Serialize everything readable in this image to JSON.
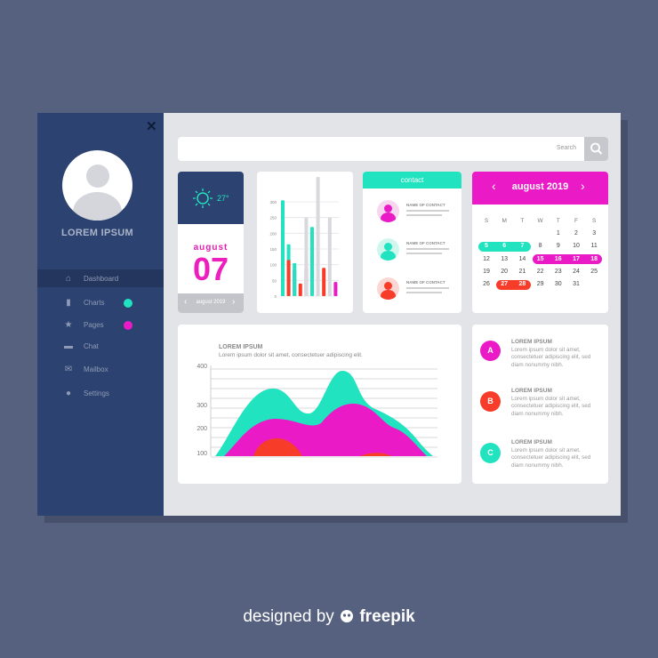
{
  "window": {
    "close_label": "✕"
  },
  "profile": {
    "name": "LOREM IPSUM"
  },
  "nav": [
    {
      "label": "Dashboard",
      "icon": "home-icon",
      "glyph": "⌂",
      "active": true
    },
    {
      "label": "Charts",
      "icon": "bar-chart-icon",
      "glyph": "▮",
      "dot_color": "#21e3bf"
    },
    {
      "label": "Pages",
      "icon": "star-icon",
      "glyph": "★",
      "dot_color": "#ea1bc6"
    },
    {
      "label": "Chat",
      "icon": "chat-icon",
      "glyph": "▬"
    },
    {
      "label": "Mailbox",
      "icon": "mail-icon",
      "glyph": "✉"
    },
    {
      "label": "Settings",
      "icon": "gear-icon",
      "glyph": "●"
    }
  ],
  "search": {
    "placeholder": "Search"
  },
  "weather": {
    "temperature": "27°",
    "month": "august",
    "day": "07",
    "nav_label": "august 2019",
    "prev": "‹",
    "next": "›"
  },
  "bar_chart": {
    "y_ticks": [
      "0",
      "50",
      "100",
      "150",
      "200",
      "250",
      "300"
    ],
    "ylim": [
      0,
      300
    ],
    "colors": [
      "#ea1bc6",
      "#21e3bf",
      "#f73c2a",
      "#d8d9dc"
    ],
    "groups": [
      {
        "values": [
          115,
          305,
          0,
          0
        ]
      },
      {
        "values": [
          0,
          165,
          115,
          0
        ]
      },
      {
        "values": [
          85,
          105,
          0,
          0
        ]
      },
      {
        "values": [
          0,
          0,
          40,
          0
        ]
      },
      {
        "values": [
          90,
          0,
          0,
          250
        ]
      },
      {
        "values": [
          0,
          220,
          0,
          0
        ]
      },
      {
        "values": [
          0,
          0,
          0,
          380
        ]
      },
      {
        "values": [
          0,
          0,
          90,
          0
        ]
      },
      {
        "values": [
          0,
          0,
          0,
          250
        ]
      },
      {
        "values": [
          45,
          0,
          0,
          0
        ]
      }
    ]
  },
  "contact": {
    "header": "contact",
    "items": [
      {
        "name": "NAME OF CONTACT",
        "color": "#ea1bc6",
        "bg": "#f7d6ef"
      },
      {
        "name": "NAME OF CONTACT",
        "color": "#21e3bf",
        "bg": "#cff7ee"
      },
      {
        "name": "NAME OF CONTACT",
        "color": "#f73c2a",
        "bg": "#fcd6d3"
      }
    ]
  },
  "calendar": {
    "title": "august 2019",
    "prev": "‹",
    "next": "›",
    "weekdays": [
      "S",
      "M",
      "T",
      "W",
      "T",
      "F",
      "S"
    ],
    "rows": [
      [
        "",
        "",
        "",
        "",
        "1",
        "2",
        "3"
      ],
      [
        "4",
        "5",
        "6",
        "7",
        "8",
        "9",
        "10"
      ],
      [
        "11",
        "12",
        "13",
        "14",
        "15",
        "16",
        "17"
      ],
      [
        "18",
        "19",
        "20",
        "21",
        "22",
        "23",
        "24"
      ],
      [
        "25",
        "26",
        "27",
        "28",
        "29",
        "30",
        "31"
      ]
    ],
    "display_rows": [
      [
        "",
        "",
        "",
        "",
        "1",
        "2",
        "3"
      ],
      [
        "4",
        "5",
        "6",
        "7",
        "8",
        "9",
        "10",
        "11"
      ],
      [
        "12",
        "13",
        "14",
        "15",
        "16",
        "17",
        "18"
      ],
      [
        "19",
        "20",
        "21",
        "22",
        "23",
        "24",
        "25"
      ],
      [
        "26",
        "27",
        "28",
        "29",
        "30",
        "31"
      ]
    ],
    "highlight_green": [
      "5",
      "6",
      "7"
    ],
    "highlight_magenta": [
      "15",
      "16",
      "17",
      "18"
    ],
    "highlight_red": [
      "27",
      "28"
    ],
    "green": "#21e3bf",
    "magenta": "#ea1bc6",
    "red": "#f73c2a"
  },
  "area_chart": {
    "title": "LOREM IPSUM",
    "subtitle": "Lorem ipsum dolor sit amet, consectetuer adipiscing elit.",
    "y_ticks": [
      "400",
      "300",
      "200",
      "100"
    ]
  },
  "list": [
    {
      "letter": "A",
      "color": "#ea1bc6",
      "title": "LOREM IPSUM",
      "text": "Lorem ipsum dolor sit amet, consectetuer adipiscing elit, sed diam nonummy nibh."
    },
    {
      "letter": "B",
      "color": "#f73c2a",
      "title": "LOREM IPSUM",
      "text": "Lorem ipsum dolor sit amet, consectetuer adipiscing elit, sed diam nonummy nibh."
    },
    {
      "letter": "C",
      "color": "#21e3bf",
      "title": "LOREM IPSUM",
      "text": "Lorem ipsum dolor sit amet, consectetuer adipiscing elit, sed diam nonummy nibh."
    }
  ],
  "brand": {
    "prefix": "designed by",
    "name": "freepik"
  }
}
